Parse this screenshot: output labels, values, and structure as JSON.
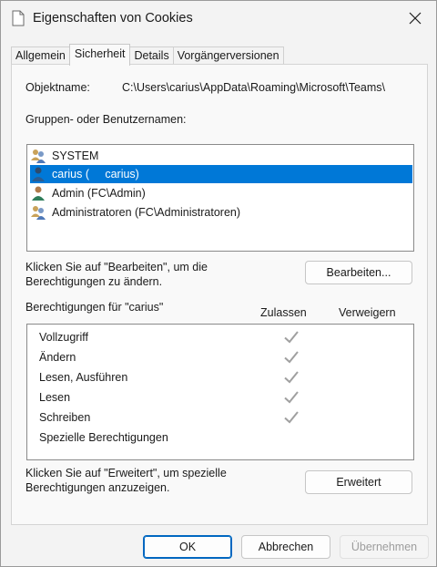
{
  "window": {
    "title": "Eigenschaften von Cookies"
  },
  "tabs": [
    {
      "label": "Allgemein",
      "active": false
    },
    {
      "label": "Sicherheit",
      "active": true
    },
    {
      "label": "Details",
      "active": false
    },
    {
      "label": "Vorgängerversionen",
      "active": false
    }
  ],
  "object": {
    "label": "Objektname:",
    "value": "C:\\Users\\carius\\AppData\\Roaming\\Microsoft\\Teams\\"
  },
  "users": {
    "label": "Gruppen- oder Benutzernamen:",
    "items": [
      {
        "name": "SYSTEM",
        "icon": "group-icon",
        "selected": false
      },
      {
        "name": "carius (     carius)",
        "icon": "user-icon",
        "selected": true
      },
      {
        "name": "Admin (FC\\Admin)",
        "icon": "user-icon",
        "selected": false
      },
      {
        "name": "Administratoren (FC\\Administratoren)",
        "icon": "group-icon",
        "selected": false
      }
    ]
  },
  "edit": {
    "hint_line1": "Klicken Sie auf \"Bearbeiten\", um die",
    "hint_line2": "Berechtigungen zu ändern.",
    "button": "Bearbeiten..."
  },
  "permissions": {
    "label": "Berechtigungen für \"carius\"",
    "col_allow": "Zulassen",
    "col_deny": "Verweigern",
    "rows": [
      {
        "name": "Vollzugriff",
        "allow": true,
        "deny": false
      },
      {
        "name": "Ändern",
        "allow": true,
        "deny": false
      },
      {
        "name": "Lesen, Ausführen",
        "allow": true,
        "deny": false
      },
      {
        "name": "Lesen",
        "allow": true,
        "deny": false
      },
      {
        "name": "Schreiben",
        "allow": true,
        "deny": false
      },
      {
        "name": "Spezielle Berechtigungen",
        "allow": false,
        "deny": false
      }
    ]
  },
  "advanced": {
    "hint_line1": "Klicken Sie auf \"Erweitert\", um spezielle",
    "hint_line2": "Berechtigungen anzuzeigen.",
    "button": "Erweitert"
  },
  "footer": {
    "ok": "OK",
    "cancel": "Abbrechen",
    "apply": "Übernehmen"
  },
  "colors": {
    "selection": "#0078d7",
    "check": "#a0a0a0",
    "primary_border": "#0067c0"
  }
}
